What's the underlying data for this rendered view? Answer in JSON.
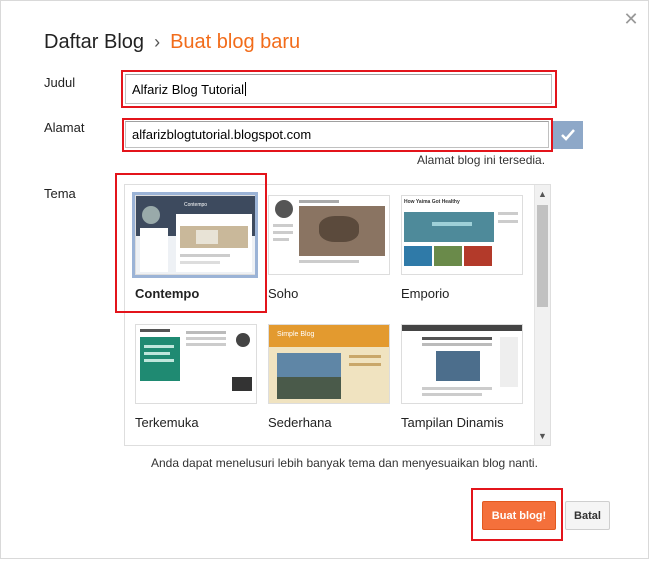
{
  "dialog": {
    "breadcrumb_root": "Daftar Blog",
    "breadcrumb_separator": "›",
    "breadcrumb_current": "Buat blog baru",
    "close_icon": "close-icon"
  },
  "form": {
    "title_label": "Judul",
    "title_value": "Alfariz Blog Tutorial",
    "address_label": "Alamat",
    "address_value": "alfarizblogtutorial.blogspot.com",
    "address_status": "Alamat blog ini tersedia.",
    "theme_label": "Tema"
  },
  "themes": {
    "items": [
      {
        "name": "Contempo",
        "selected": true
      },
      {
        "name": "Soho",
        "selected": false
      },
      {
        "name": "Emporio",
        "selected": false
      },
      {
        "name": "Terkemuka",
        "selected": false
      },
      {
        "name": "Sederhana",
        "selected": false
      },
      {
        "name": "Tampilan Dinamis",
        "selected": false
      }
    ],
    "thumb_texts": {
      "emporio_heading": "How Yaima Got Healthy",
      "sederhana_heading": "Simple Blog",
      "contempo_heading": "Contempo"
    }
  },
  "footer": {
    "note": "Anda dapat menelusuri lebih banyak tema dan menyesuaikan blog nanti.",
    "create_button": "Buat blog!",
    "cancel_button": "Batal"
  },
  "colors": {
    "accent_orange": "#f26c1a",
    "button_orange": "#f4703b",
    "highlight_red": "#e3141b",
    "check_blue": "#8ea8c8"
  }
}
